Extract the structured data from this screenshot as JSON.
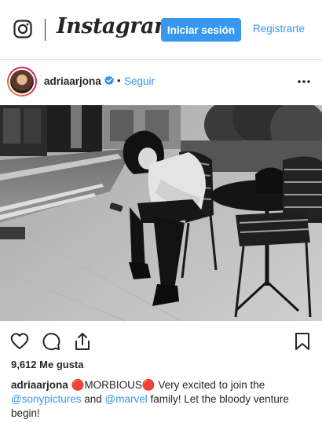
{
  "header": {
    "wordmark": "Instagram",
    "login_label": "Iniciar sesión",
    "register_label": "Registrarte"
  },
  "post": {
    "username": "adriaarjona",
    "follow_label": "Seguir",
    "likes": "9,612 Me gusta",
    "caption": {
      "username": "adriaarjona",
      "text_1": " 🔴MORBIOUS🔴 Very excited to join the ",
      "mention_1": "@sonypictures",
      "text_2": " and ",
      "mention_2": "@marvel",
      "text_3": " family! Let the bloody venture begin!"
    }
  },
  "icons": {
    "logo": "instagram-glyph-icon",
    "verified": "verified-badge-icon",
    "more": "more-options-icon",
    "like": "heart-icon",
    "comment": "comment-icon",
    "share": "share-icon",
    "save": "bookmark-icon"
  },
  "colors": {
    "accent": "#3897f0",
    "text": "#262626",
    "border": "#dbdbdb"
  }
}
